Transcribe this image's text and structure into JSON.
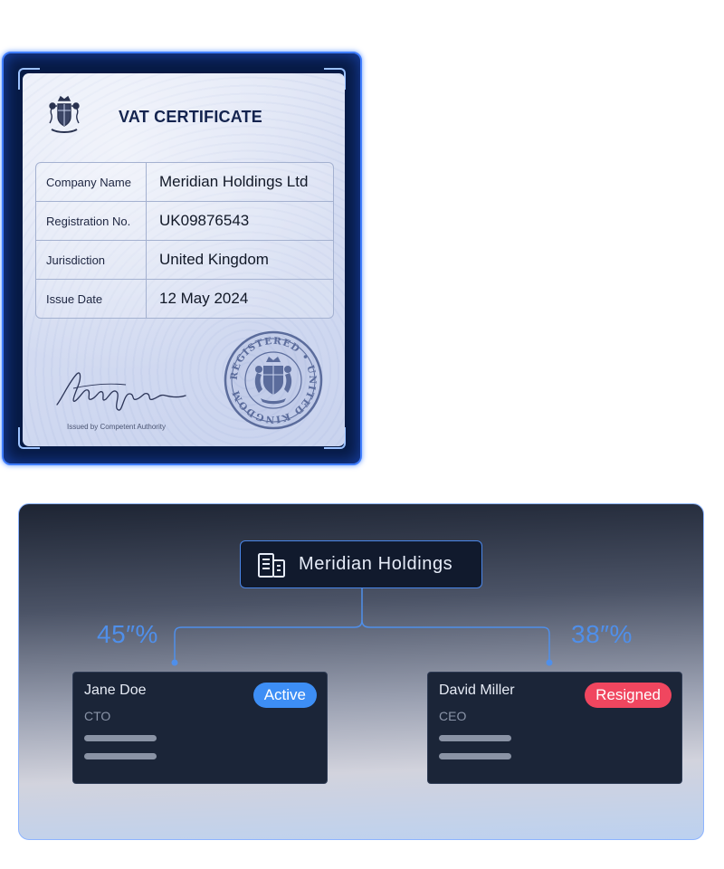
{
  "certificate": {
    "title": "VAT CERTIFICATE",
    "fields": [
      {
        "label": "Company Name",
        "value": "Meridian Holdings Ltd"
      },
      {
        "label": "Registration No.",
        "value": "UK09876543"
      },
      {
        "label": "Jurisdiction",
        "value": "United Kingdom"
      },
      {
        "label": "Issue Date",
        "value": "12 May 2024"
      }
    ],
    "issued_by": "Issued by Competent Authority",
    "seal_text": "REGISTERED • UNITED KINGDOM",
    "crest_icon": "royal-crest-icon"
  },
  "org_chart": {
    "root": {
      "label": "Meridian Holdings",
      "icon": "building-icon"
    },
    "shareholders": [
      {
        "share": "45″%",
        "name": "Jane Doe",
        "role": "CTO",
        "status": "Active",
        "status_color": "#3d8ef5"
      },
      {
        "share": "38″%",
        "name": "David Miller",
        "role": "CEO",
        "status": "Resigned",
        "status_color": "#f0465f"
      }
    ]
  },
  "colors": {
    "frame_glow": "#3f7dff",
    "accent_blue": "#4f8fea",
    "panel_border": "#8db4ff"
  }
}
